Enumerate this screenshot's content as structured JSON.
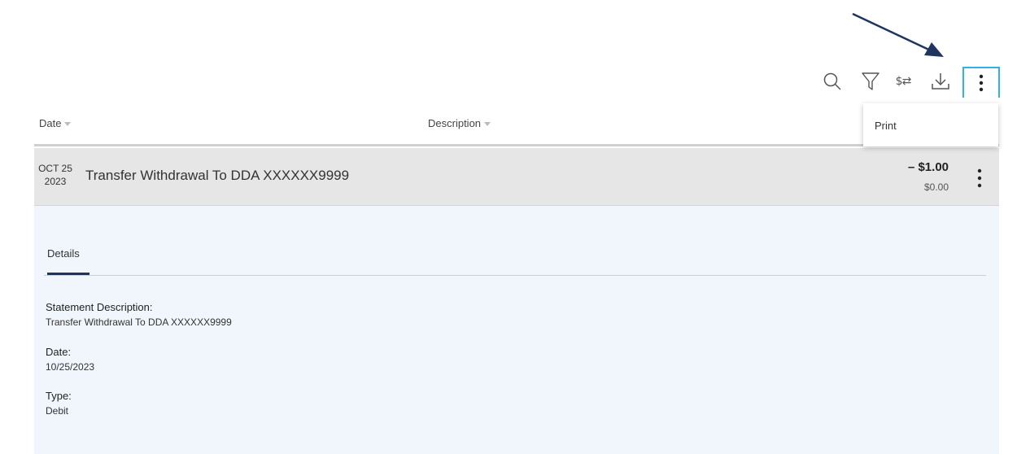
{
  "toolbar": {
    "search_icon": "search-icon",
    "filter_icon": "filter-icon",
    "swap_label": "$⇄",
    "download_icon": "download-icon",
    "more_icon": "more-vertical-icon",
    "accent_color": "#2eb3e6"
  },
  "dropdown": {
    "items": [
      "Print"
    ]
  },
  "table": {
    "columns": [
      "Date",
      "Description"
    ]
  },
  "transaction": {
    "month_day": "OCT 25",
    "year": "2023",
    "description": "Transfer Withdrawal To DDA XXXXXX9999",
    "amount": "– $1.00",
    "balance": "$0.00"
  },
  "details": {
    "tab_label": "Details",
    "fields": [
      {
        "label": "Statement Description:",
        "value": "Transfer Withdrawal To DDA XXXXXX9999"
      },
      {
        "label": "Date:",
        "value": "10/25/2023"
      },
      {
        "label": "Type:",
        "value": "Debit"
      }
    ]
  },
  "colors": {
    "row_bg": "#e6e6e6",
    "details_bg": "#f0f6fb",
    "tab_underline": "#1f3560",
    "arrow": "#1f3560"
  }
}
